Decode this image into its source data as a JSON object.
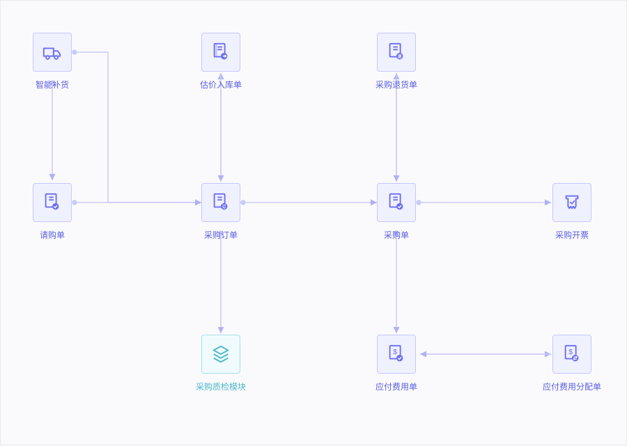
{
  "nodes": {
    "smart_restock": {
      "label": "智能补货",
      "icon": "truck-icon"
    },
    "purchase_req": {
      "label": "请购单",
      "icon": "doc-check-icon"
    },
    "est_inbound": {
      "label": "估价入库单",
      "icon": "doc-arrow-icon"
    },
    "purchase_order": {
      "label": "采购订单",
      "icon": "doc-order-icon"
    },
    "qc_module": {
      "label": "采购质检模块",
      "icon": "layers-icon"
    },
    "purchase_return": {
      "label": "采购退货单",
      "icon": "doc-return-icon"
    },
    "purchase_note": {
      "label": "采购单",
      "icon": "doc-check-icon"
    },
    "payable_fee": {
      "label": "应付费用单",
      "icon": "doc-money-icon"
    },
    "invoice": {
      "label": "采购开票",
      "icon": "receipt-icon"
    },
    "fee_alloc": {
      "label": "应付费用分配单",
      "icon": "doc-swap-icon"
    }
  },
  "colors": {
    "accent": "#6a6ef0",
    "accent_light": "#c5c7ff",
    "cyan": "#4db8cc"
  }
}
